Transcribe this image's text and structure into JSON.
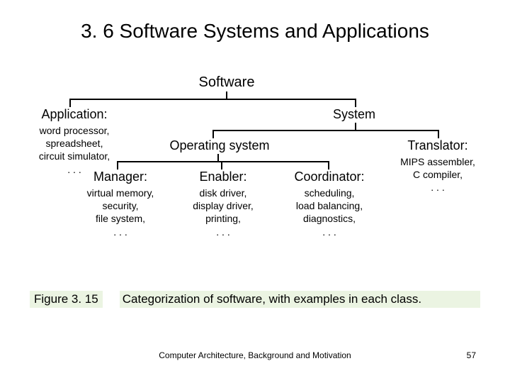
{
  "title": "3. 6  Software Systems and Applications",
  "tree": {
    "root": "Software",
    "application": {
      "head": "Application:",
      "ex1": "word processor,",
      "ex2": "spreadsheet,",
      "ex3": "circuit simulator,",
      "dots": ". . ."
    },
    "system": {
      "head": "System",
      "os": {
        "head": "Operating system",
        "manager": {
          "head": "Manager:",
          "ex1": "virtual memory,",
          "ex2": "security,",
          "ex3": "file system,",
          "dots": ". . ."
        },
        "enabler": {
          "head": "Enabler:",
          "ex1": "disk driver,",
          "ex2": "display driver,",
          "ex3": "printing,",
          "dots": ". . ."
        },
        "coordinator": {
          "head": "Coordinator:",
          "ex1": "scheduling,",
          "ex2": "load balancing,",
          "ex3": "diagnostics,",
          "dots": ". . ."
        }
      },
      "translator": {
        "head": "Translator:",
        "ex1": "MIPS assembler,",
        "ex2": "C compiler,",
        "dots": ". . ."
      }
    }
  },
  "caption": {
    "label": "Figure 3. 15",
    "text": "Categorization of software, with examples in each class."
  },
  "footer": "Computer Architecture, Background and Motivation",
  "page": "57"
}
